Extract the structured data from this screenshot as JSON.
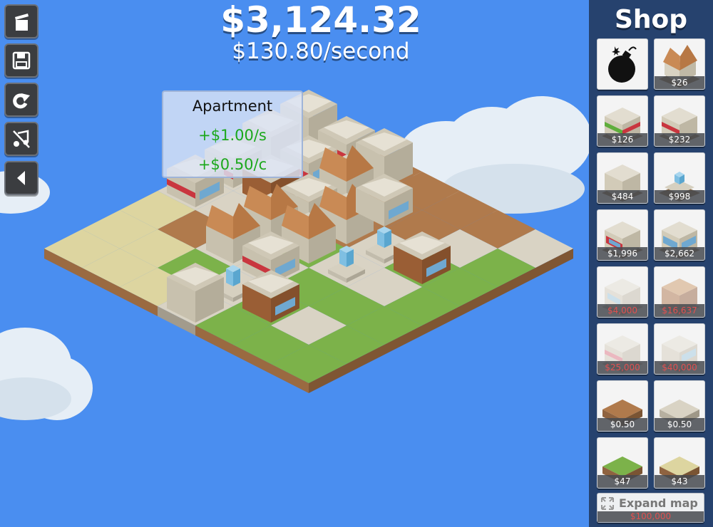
{
  "money": {
    "total": "$3,124.32",
    "rate": "$130.80/second"
  },
  "tools": [
    "clear-icon",
    "save-icon",
    "rotate-icon",
    "mute-music-icon",
    "collapse-icon"
  ],
  "tooltip": {
    "title": "Apartment",
    "per_second": "+$1.00/s",
    "per_click": "+$0.50/c"
  },
  "shop": {
    "title": "Shop",
    "items": [
      {
        "name": "bomb",
        "price": ""
      },
      {
        "name": "house",
        "price": "$26"
      },
      {
        "name": "green-awning-shop",
        "price": "$126"
      },
      {
        "name": "red-awning-shop",
        "price": "$232"
      },
      {
        "name": "apartment",
        "price": "$484"
      },
      {
        "name": "fountain",
        "price": "$998"
      },
      {
        "name": "red-office",
        "price": "$1,996"
      },
      {
        "name": "blue-office",
        "price": "$2,662"
      },
      {
        "name": "tower-1",
        "price": "$4,000",
        "locked": true
      },
      {
        "name": "tower-2",
        "price": "$16,637",
        "locked": true
      },
      {
        "name": "tower-3",
        "price": "$25,000",
        "locked": true
      },
      {
        "name": "tower-4",
        "price": "$40,000",
        "locked": true
      },
      {
        "name": "dirt-tile",
        "price": "$0.50"
      },
      {
        "name": "pavement-tile",
        "price": "$0.50"
      },
      {
        "name": "grass-tile",
        "price": "$47"
      },
      {
        "name": "sand-tile",
        "price": "$43"
      }
    ],
    "expand": {
      "label": "Expand map",
      "price": "$100,000"
    }
  },
  "colors": {
    "sky": "#4a8ef0",
    "shop_panel": "#26426e",
    "income_green": "#1ca81c",
    "locked_price": "#e05050"
  }
}
